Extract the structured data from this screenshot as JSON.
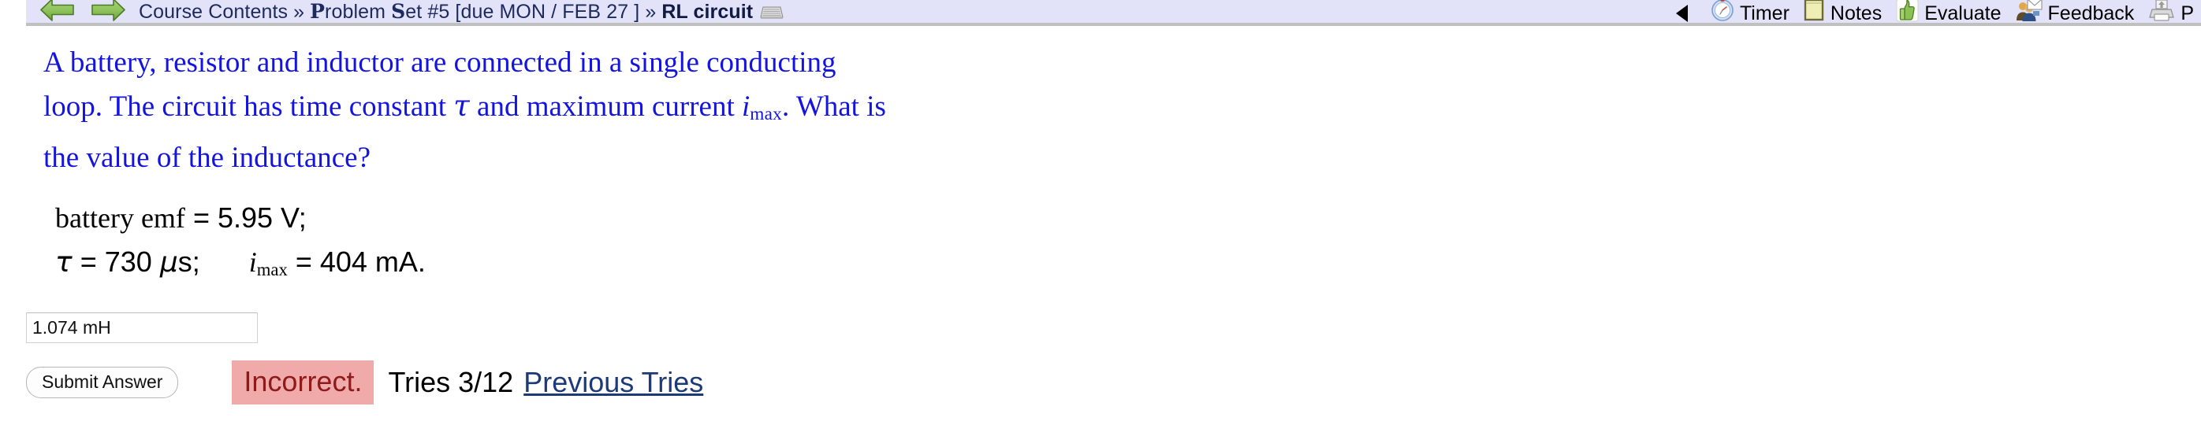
{
  "topbar": {
    "back_icon": "green-left-arrow-icon",
    "forward_icon": "green-right-arrow-icon",
    "breadcrumb": {
      "root": "Course Contents",
      "separator": "»",
      "set_prefix": "P",
      "set_part1": "roblem ",
      "set_prefix2": "S",
      "set_part2": "et #5 [due MON / FEB 27 ]",
      "current": "RL circuit",
      "keyboard_icon": "keyboard-icon"
    },
    "tools": [
      {
        "id": "collapse",
        "label": "",
        "icon": "left-triangle-icon"
      },
      {
        "id": "timer",
        "label": "Timer",
        "icon": "clock-icon"
      },
      {
        "id": "notes",
        "label": "Notes",
        "icon": "note-icon"
      },
      {
        "id": "evaluate",
        "label": "Evaluate",
        "icon": "thumbs-up-icon"
      },
      {
        "id": "feedback",
        "label": "Feedback",
        "icon": "feedback-people-icon"
      },
      {
        "id": "print",
        "label": "P",
        "icon": "printer-icon"
      }
    ]
  },
  "problem": {
    "question_line1": "A battery, resistor and inductor are connected in a single conducting",
    "question_line2_a": "loop. The circuit has time constant ",
    "question_tau": "τ",
    "question_line2_b": " and maximum current ",
    "question_i": "i",
    "question_i_sub": "max",
    "question_line2_c": ". What is",
    "question_line3": "the value of the inductance?",
    "givens": {
      "emf_label": "battery emf",
      "emf_value": "=  5.95 V;",
      "tau_symbol": "τ",
      "tau_value": "=  730",
      "tau_unit_mu": "μ",
      "tau_unit_rest": "s;",
      "imax_symbol": "i",
      "imax_sub": "max",
      "imax_value": "=  404 mA."
    }
  },
  "answer": {
    "input_value": "1.074 mH",
    "input_placeholder": "",
    "submit_label": "Submit Answer",
    "verdict": "Incorrect.",
    "tries": "Tries 3/12",
    "previous_tries_link": "Previous Tries"
  },
  "colors": {
    "topbar_bg": "#e2e2f8",
    "question_blue": "#1414e0",
    "breadcrumb_blue": "#1d2a5e",
    "verdict_bg": "#f0aaaa",
    "verdict_fg": "#8e1a1a",
    "link_blue": "#1d3a78",
    "arrow_green": "#7cbb46"
  }
}
